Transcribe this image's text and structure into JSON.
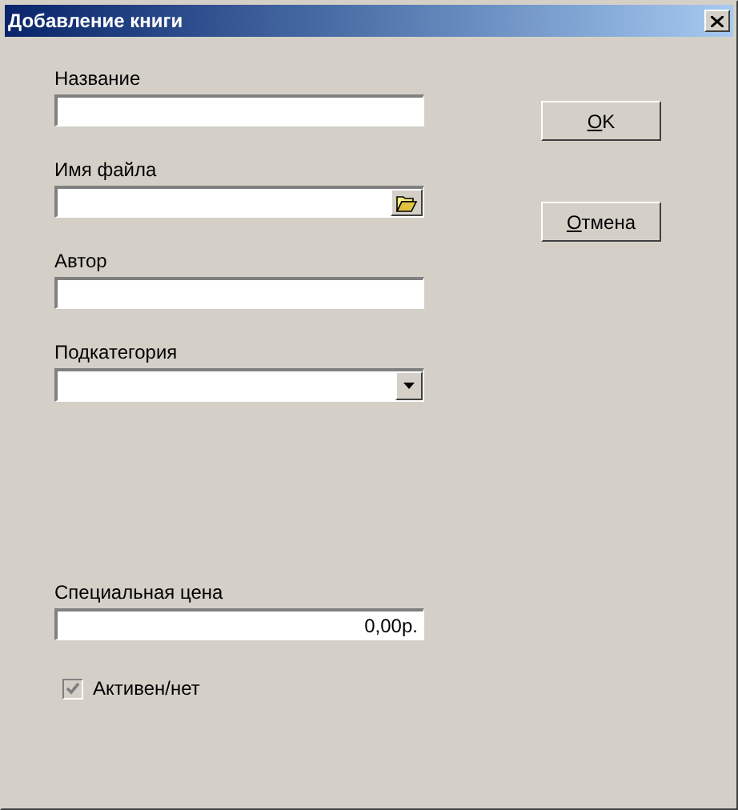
{
  "window": {
    "title": "Добавление книги"
  },
  "fields": [
    {
      "label": "Название",
      "kind": "text"
    },
    {
      "label": "Имя файла",
      "kind": "file"
    },
    {
      "label": "Автор",
      "kind": "text"
    },
    {
      "label": "Подкатегория",
      "kind": "combo"
    },
    {
      "label": "Специальная цена",
      "kind": "text",
      "value": "0,00р."
    }
  ],
  "buttons": [
    {
      "label": "OK"
    },
    {
      "label": "Отмена"
    }
  ],
  "checkbox": {
    "label": "Активен/нет",
    "checked": true,
    "disabled": true
  }
}
